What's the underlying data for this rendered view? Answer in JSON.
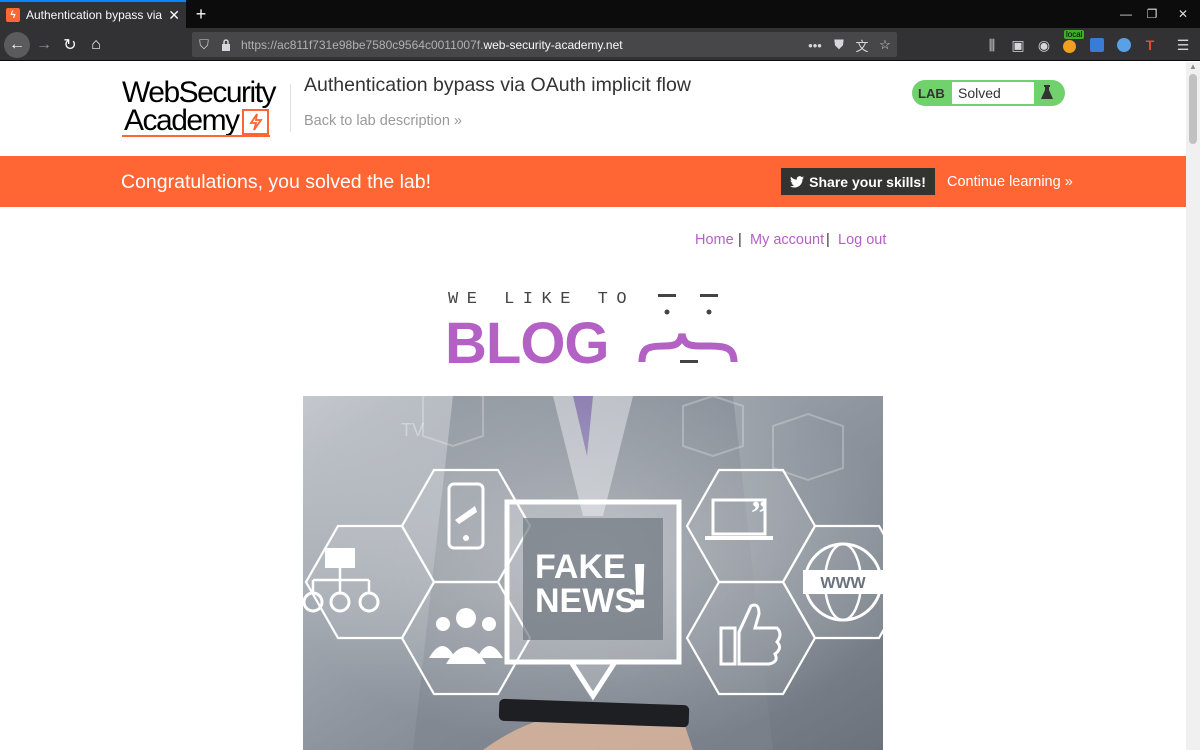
{
  "browser": {
    "tab_title": "Authentication bypass via OAuth implicit flow",
    "url_prefix": "https://ac811f731e98be7580c9564c0011007f.",
    "url_domain": "web-security-academy.net",
    "extension_badge": "local"
  },
  "header": {
    "logo_line1": "WebSecurity",
    "logo_line2": "Academy",
    "lab_title": "Authentication bypass via OAuth implicit flow",
    "back_link": "Back to lab description",
    "lab_badge": "LAB",
    "lab_status": "Solved"
  },
  "banner": {
    "message": "Congratulations, you solved the lab!",
    "share_button": "Share your skills!",
    "continue_link": "Continue learning"
  },
  "nav": {
    "home": "Home",
    "account": "My account",
    "logout": "Log out",
    "separator": "|"
  },
  "blog_logo": {
    "tagline": "WE LIKE TO",
    "word": "BLOG"
  },
  "hero": {
    "headline_1": "FAKE",
    "headline_2": "NEWS",
    "exclaim": "!",
    "www": "WWW",
    "tv": "TV"
  },
  "colors": {
    "accent_orange": "#ff6633",
    "link_purple": "#b361c4",
    "solved_green": "#70d16d",
    "chrome_dark": "#323234"
  }
}
